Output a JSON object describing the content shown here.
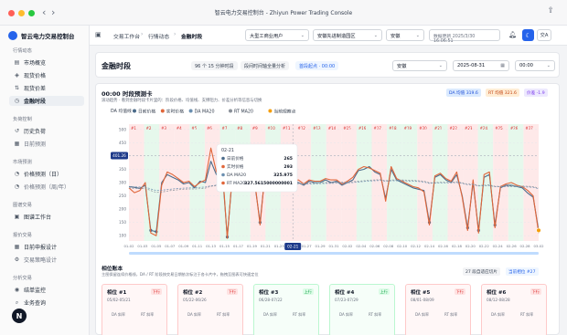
{
  "window": {
    "title": "智云电力交易控制台 - Zhiyun Power Trading Console"
  },
  "sidebar": {
    "brand": "智云电力交易控制台",
    "sections": [
      {
        "label": "行情动态",
        "items": [
          {
            "label": "市场概览",
            "icon": "chart-icon"
          },
          {
            "label": "现货价格",
            "icon": "price-icon"
          },
          {
            "label": "现货价差",
            "icon": "spread-icon"
          },
          {
            "label": "金融时段",
            "icon": "clock-icon",
            "active": true
          }
        ]
      },
      {
        "label": "负荷控制",
        "items": [
          {
            "label": "历史负荷",
            "icon": "history-icon"
          },
          {
            "label": "日前预测",
            "icon": "calendar-icon",
            "sub": true
          }
        ]
      },
      {
        "label": "市场预测",
        "items": [
          {
            "label": "价格预测（日）",
            "icon": "forecast-icon"
          },
          {
            "label": "价格预测（周/年）",
            "icon": "forecast-icon",
            "sub": true
          }
        ]
      },
      {
        "label": "图谱交易",
        "items": [
          {
            "label": "图谱工作台",
            "icon": "workbench-icon"
          }
        ]
      },
      {
        "label": "报价交易",
        "items": [
          {
            "label": "日前申报设计",
            "icon": "calendar-icon"
          },
          {
            "label": "交易策略设计",
            "icon": "strategy-icon",
            "sub": true
          }
        ]
      },
      {
        "label": "分析交易",
        "items": [
          {
            "label": "结单监控",
            "icon": "monitor-icon"
          },
          {
            "label": "业务查询",
            "icon": "search-icon"
          }
        ]
      }
    ],
    "avatar_letter": "N"
  },
  "topbar": {
    "breadcrumbs": [
      "交易工作台",
      "行情动态",
      "金融时段"
    ],
    "customer_select": "大型工商业用户",
    "region_select": "安徽先进制造园区",
    "province_select": "安徽",
    "data_updated": "数据更新 2025/3/30 16:06:51",
    "user_label": "交A"
  },
  "header": {
    "title": "金融时段",
    "chips": [
      "96 个 15 分钟时段",
      "段间时间轴全量分析",
      "首段起点 · 00:00"
    ],
    "province": "安徽",
    "date": "2025-08-31",
    "time": "00:00"
  },
  "analysis": {
    "title": "00:00 时段预测卡",
    "subtitle": "滚动趋势 · 看到金融时段卡片里的：阶段价格、均值线、支撑阻力、价差分析等信息与切换",
    "da_avg": "DA 均值 319.6",
    "rt_avg": "RT 均值 321.6",
    "spread": "价差 -1.9"
  },
  "chart_data": {
    "type": "line",
    "legend_title": "DA 均值线",
    "legend": [
      "日前价格",
      "实时价格",
      "DA MA20",
      "RT MA20",
      "当前观察点"
    ],
    "colors": {
      "day_ahead": "#4b6b8a",
      "real_time": "#e0663a",
      "da_ma20": "#6b8fb0",
      "rt_ma20": "#8a9099",
      "band_red": "#fde2e2",
      "band_green": "#def5e6"
    },
    "yticks": [
      500,
      450,
      400,
      350,
      300,
      250,
      200,
      150,
      100
    ],
    "ylim": [
      80,
      520
    ],
    "y_current_tag": "401.26",
    "xticks": [
      "01-02",
      "01-03",
      "01-05",
      "01-07",
      "01-09",
      "01-11",
      "01-13",
      "01-15",
      "01-17",
      "01-19",
      "01-21",
      "01-23",
      "01-25",
      "01-27",
      "01-29",
      "01-31",
      "02-02",
      "02-04",
      "02-06",
      "02-08",
      "02-10",
      "02-12",
      "02-14",
      "02-16",
      "02-18",
      "02-20",
      "02-22",
      "02-24",
      "02-26",
      "02-28",
      "03-02"
    ],
    "x_current_tag": "02-21",
    "segment_markers": [
      "#1",
      "#2",
      "#3",
      "#4",
      "#5",
      "#6",
      "#7",
      "#8",
      "#9",
      "#10",
      "#11",
      "#12",
      "#13",
      "#14",
      "#15",
      "#16",
      "#17",
      "#18",
      "#19",
      "#20",
      "#21",
      "#22",
      "#23",
      "#24",
      "#25",
      "#26",
      "#27"
    ],
    "band_states": [
      "down",
      "up",
      "down",
      "down",
      "up",
      "down",
      "up",
      "up",
      "down",
      "up",
      "down",
      "down",
      "up",
      "down",
      "down",
      "up",
      "down",
      "up",
      "up",
      "down",
      "up",
      "down",
      "down",
      "up",
      "down",
      "up",
      "down"
    ],
    "series": [
      {
        "name": "日前价格",
        "values": [
          285,
          282,
          278,
          290,
          120,
          115,
          300,
          330,
          320,
          310,
          295,
          300,
          280,
          305,
          300,
          380,
          330,
          370,
          95,
          340,
          310,
          320,
          330,
          300,
          150,
          350,
          330,
          340,
          300,
          330,
          310,
          300,
          290,
          305,
          300,
          300,
          310,
          300,
          305,
          290,
          300,
          310,
          345,
          350,
          360,
          340,
          330,
          240,
          350,
          310,
          300,
          290,
          280,
          275,
          270,
          150,
          320,
          330,
          310,
          300,
          330,
          250,
          130,
          300,
          120,
          320,
          330,
          140,
          280,
          290,
          290,
          285,
          280,
          260,
          245,
          120
        ]
      },
      {
        "name": "实时价格",
        "values": [
          280,
          262,
          270,
          300,
          110,
          100,
          290,
          340,
          330,
          315,
          300,
          305,
          285,
          300,
          310,
          430,
          340,
          390,
          90,
          350,
          320,
          330,
          335,
          310,
          140,
          355,
          335,
          345,
          310,
          335,
          305,
          310,
          295,
          310,
          305,
          305,
          315,
          310,
          310,
          295,
          305,
          320,
          350,
          360,
          355,
          345,
          335,
          230,
          360,
          315,
          305,
          295,
          285,
          280,
          265,
          140,
          325,
          335,
          315,
          305,
          340,
          245,
          120,
          310,
          110,
          330,
          340,
          130,
          285,
          295,
          300,
          290,
          285,
          270,
          250,
          110
        ]
      },
      {
        "name": "DA MA20",
        "values": [
          285,
          284,
          283,
          283,
          276,
          270,
          271,
          274,
          276,
          278,
          279,
          280,
          280,
          282,
          283,
          288,
          290,
          292,
          286,
          289,
          290,
          291,
          292,
          292,
          286,
          289,
          290,
          292,
          292,
          294,
          294,
          294,
          294,
          295,
          295,
          296,
          297,
          297,
          298,
          298,
          299,
          300,
          302,
          304,
          306,
          307,
          308,
          305,
          307,
          307,
          307,
          306,
          305,
          304,
          302,
          297,
          298,
          299,
          299,
          299,
          300,
          297,
          292,
          292,
          287,
          288,
          289,
          284,
          284,
          284,
          284,
          284,
          284,
          283,
          282,
          277
        ]
      },
      {
        "name": "RT MA20",
        "values": [
          280,
          278,
          277,
          278,
          270,
          263,
          264,
          268,
          271,
          273,
          275,
          276,
          276,
          277,
          279,
          286,
          288,
          292,
          286,
          289,
          291,
          292,
          294,
          294,
          288,
          291,
          293,
          295,
          295,
          297,
          297,
          297,
          297,
          298,
          298,
          299,
          300,
          300,
          301,
          301,
          302,
          303,
          305,
          307,
          309,
          310,
          311,
          307,
          310,
          310,
          310,
          309,
          308,
          307,
          305,
          299,
          300,
          301,
          301,
          301,
          303,
          299,
          294,
          294,
          289,
          290,
          291,
          286,
          286,
          287,
          287,
          287,
          287,
          286,
          285,
          279
        ]
      }
    ],
    "tooltip": {
      "date": "02-21",
      "rows": [
        {
          "label": "日前价格",
          "value": "265"
        },
        {
          "label": "实时价格",
          "value": "293"
        },
        {
          "label": "DA MA20",
          "value": "325.975"
        },
        {
          "label": "RT MA20",
          "value": "327.5615000000001"
        }
      ]
    }
  },
  "table": {
    "title": "相位账本",
    "subtitle": "主图保留连续价格线，DA / RT 阶段按交易日期依次标注于各卡片中，拖拽至图表可快速定位",
    "count_label": "27 段自适应切片",
    "current_label": "当前相位 #27",
    "segments": [
      {
        "name": "相位 #1",
        "tag": "下行",
        "dates": "05/02-05/21",
        "m1": "DA 斜率",
        "m2": "RT 斜率",
        "up": false
      },
      {
        "name": "相位 #2",
        "tag": "下行",
        "dates": "05/22-06/26",
        "m1": "DA 斜率",
        "m2": "RT 斜率",
        "up": false
      },
      {
        "name": "相位 #3",
        "tag": "上行",
        "dates": "06/28-07/22",
        "m1": "DA 斜率",
        "m2": "RT 斜率",
        "up": true
      },
      {
        "name": "相位 #4",
        "tag": "上行",
        "dates": "07/23-07/29",
        "m1": "DA 斜率",
        "m2": "RT 斜率",
        "up": true
      },
      {
        "name": "相位 #5",
        "tag": "下行",
        "dates": "08/01-08/09",
        "m1": "DA 斜率",
        "m2": "RT 斜率",
        "up": false
      },
      {
        "name": "相位 #6",
        "tag": "下行",
        "dates": "08/12-08/28",
        "m1": "DA 斜率",
        "m2": "RT 斜率",
        "up": false
      }
    ]
  }
}
